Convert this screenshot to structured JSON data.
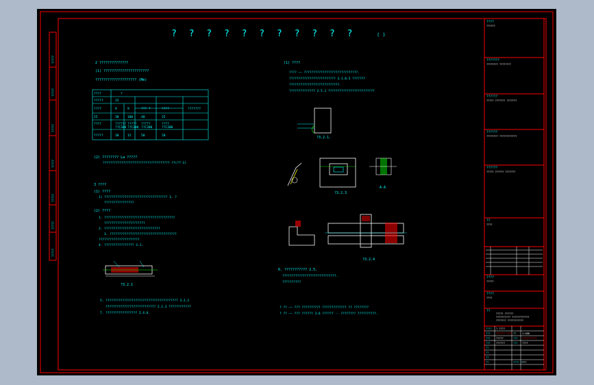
{
  "drawing": {
    "title": "? ? ? ? ? ? ? ? ? ? ?",
    "title_suffix": "( )",
    "left_col_heading": "2 ??????????????",
    "left_sub_1": "(1) ??????????????????????",
    "left_line_1": "???????????????????? (Mm)",
    "table_unit": "(Mm)",
    "table_header": [
      "????",
      "?",
      "",
      "",
      "",
      "",
      "",
      ""
    ],
    "table_rows": [
      [
        "?????",
        "15",
        "",
        "",
        "",
        "",
        ""
      ],
      [
        "????",
        "9",
        "9",
        "??? ?",
        "????",
        "???????"
      ],
      [
        "",
        "",
        "",
        "",
        "",
        "",
        ""
      ],
      [
        "25",
        "30",
        "100",
        "40",
        "25",
        ""
      ],
      [
        "????",
        "??????",
        "?????",
        "?????",
        "????",
        ""
      ],
      [
        "",
        "??C300",
        "??C300",
        "??C300",
        "??C300",
        ""
      ],
      [
        "?????",
        "30",
        "15",
        "50",
        "20",
        ""
      ]
    ],
    "left_sub_2": "(2) ???????? La ?????",
    "left_sub_2_note": "???????????????????????????????????? ??(??-1)",
    "section_3": "3 ????",
    "section_3_1": "(1) ????",
    "section_3_1_text": "1) ?????????????????????????????????? 1. ?",
    "section_3_1_text2": "????????????????",
    "section_3_2": "(2) ????",
    "steps": [
      "1. ??????????????????????????????????????",
      "??????????????????????",
      "2. ??????????????????????????????",
      "3. ????????????????????????????????????",
      "??????????????????????",
      "4. ???????????????? 3.1."
    ],
    "fig_label_left": "?3.2.1",
    "bottom_notes": [
      "5. ??????????????????????????????????????? 3.2.2",
      "??????????????????????????? 2.2.3 ????????????",
      "7. ????????????????? 2.4.6."
    ],
    "right_sub_1": "(1) ????",
    "right_lines": [
      "???? —— ?????????????????????????????.",
      "????????????????????????? 3.1.0.5 ???????",
      "???????????????????????????.",
      "?????????????? 2.5.1 ?????????????????????????"
    ],
    "fig_labels": [
      "?3.2.1.",
      "?3.2.3",
      "A-A",
      "?3.2.4"
    ],
    "right_para_6": "6. ??????????? 2.5.",
    "right_para_6_lines": [
      "?????????????????????????????.",
      "??????????"
    ],
    "right_note_1": "? ?? —— ??? ??????????    ?????????????     ?? ????????",
    "right_note_2": "? ?? —— ??? ?????? 3.6 ?????? -- ???????? ??????????."
  },
  "side_labels": [
    "?????",
    "?????",
    "?????",
    "?????",
    "?????",
    "?????",
    "?????"
  ],
  "title_block": {
    "field_1_label": "????",
    "field_1_value": "??????",
    "field_2_label": "???????",
    "field_2_value": "????????  ????????",
    "field_3_label": "??????",
    "field_3_value": "????? ??????? ???????",
    "field_4_label": "??????",
    "field_4_value": "???????? ????????????",
    "field_5_label": "??????",
    "field_5_value": "????? ?????? ???????",
    "field_6_label": "??",
    "field_6_value": "????",
    "field_7_label": "????",
    "field_7_value": "?????",
    "field_8_label": "????",
    "field_8_value": "????",
    "project_label": "??",
    "project_text": [
      "????? ??????",
      "?????????? ????????????",
      "??????? ???????????"
    ],
    "rows": [
      [
        "????",
        "? ????"
      ],
      [
        "???",
        "??????  ???? ?",
        "??",
        "1:100"
      ],
      [
        "???",
        "?????",
        "???",
        "??????????"
      ],
      [
        "???",
        "??????",
        "???",
        "????"
      ],
      [
        "??",
        ""
      ],
      [
        "??",
        ""
      ],
      [
        "??",
        ""
      ],
      [
        "??",
        "",
        "???? ??",
        "???"
      ]
    ]
  },
  "colors": {
    "sheet_bg": "#000000",
    "frame": "#ff0000",
    "text": "#00ffff",
    "line": "#ffffff",
    "accent": "#00ff00",
    "magenta": "#ff00ff",
    "outer_bg": "#aeb9c9"
  }
}
